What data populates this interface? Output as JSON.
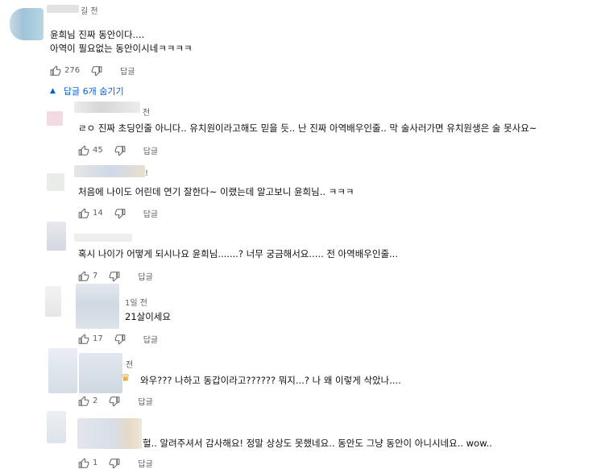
{
  "top_comment": {
    "time_partial": "길 전",
    "lines": [
      "윤희님 진짜 동안이다....",
      "아역이 필요없는 동안이시네ㅋㅋㅋㅋ"
    ],
    "likes": "276",
    "reply_label": "답글"
  },
  "replies_toggle": {
    "label": "답글 6개 숨기기"
  },
  "replies": [
    {
      "meta": "전",
      "text": "ㄹㅇ 진짜 초딩인줄 아니다.. 유치원이라고해도 믿을 듯.. 난 진짜 아역배우인줄.. 막 술사러가면 유치원생은 술 못사요~",
      "likes": "45",
      "reply_label": "답글"
    },
    {
      "meta": "!",
      "text": "처음에 나이도 어린데 연기 잘한다~ 이랬는데 알고보니 윤희님.. ㅋㅋㅋ",
      "likes": "14",
      "reply_label": "답글"
    },
    {
      "meta": "",
      "text": "혹시 나이가 어떻게 되시나요 윤희님.......? 너무 궁금해서요..... 전 아역배우인줄...",
      "likes": "7",
      "reply_label": "답글"
    },
    {
      "meta": "1일 전",
      "text": "21살이세요",
      "likes": "17",
      "reply_label": "답글"
    },
    {
      "meta": "전",
      "text": "와우??? 나하고 동갑이라고?????? 뭐지...? 나 왜 이렇게 삭았나....",
      "likes": "2",
      "reply_label": "답글"
    },
    {
      "meta": "",
      "text": "헐.. 알려주셔서 감사해요! 정말 상상도 못했네요.. 동안도 그냥 동안이 아니시네요.. wow..",
      "likes": "1",
      "reply_label": "답글"
    }
  ],
  "colors": {
    "link": "#065fd4",
    "meta": "#606060",
    "text": "#0f0f0f"
  }
}
